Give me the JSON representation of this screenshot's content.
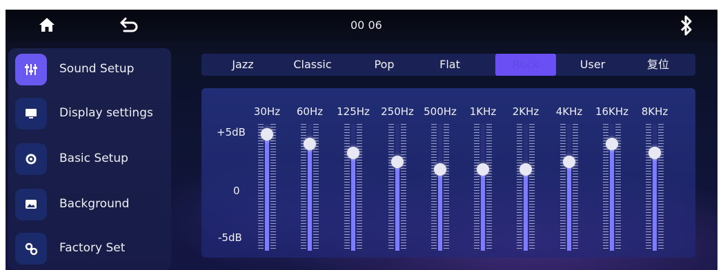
{
  "topbar": {
    "time": "00 06"
  },
  "sidebar": {
    "items": [
      {
        "label": "Sound Setup",
        "icon": "equalizer-icon",
        "active": true
      },
      {
        "label": "Display settings",
        "icon": "monitor-icon"
      },
      {
        "label": "Basic Setup",
        "icon": "gear-icon"
      },
      {
        "label": "Background",
        "icon": "image-icon"
      },
      {
        "label": "Factory Set",
        "icon": "gears-icon"
      }
    ]
  },
  "presets": {
    "items": [
      "Jazz",
      "Classic",
      "Pop",
      "Flat",
      "Rock",
      "User",
      "复位"
    ],
    "selected": "Rock"
  },
  "eq": {
    "scale": {
      "top": "+5dB",
      "mid": "0",
      "bottom": "-5dB"
    },
    "bands": [
      {
        "freq": "30Hz",
        "level": 0.92
      },
      {
        "freq": "60Hz",
        "level": 0.84
      },
      {
        "freq": "125Hz",
        "level": 0.77
      },
      {
        "freq": "250Hz",
        "level": 0.7
      },
      {
        "freq": "500Hz",
        "level": 0.64
      },
      {
        "freq": "1KHz",
        "level": 0.64
      },
      {
        "freq": "2KHz",
        "level": 0.64
      },
      {
        "freq": "4KHz",
        "level": 0.7
      },
      {
        "freq": "16KHz",
        "level": 0.84
      },
      {
        "freq": "8KHz",
        "level": 0.77
      }
    ]
  },
  "colors": {
    "accent": "#6a59f0",
    "fill": "#7d7bff",
    "panel": "#1a2155"
  }
}
